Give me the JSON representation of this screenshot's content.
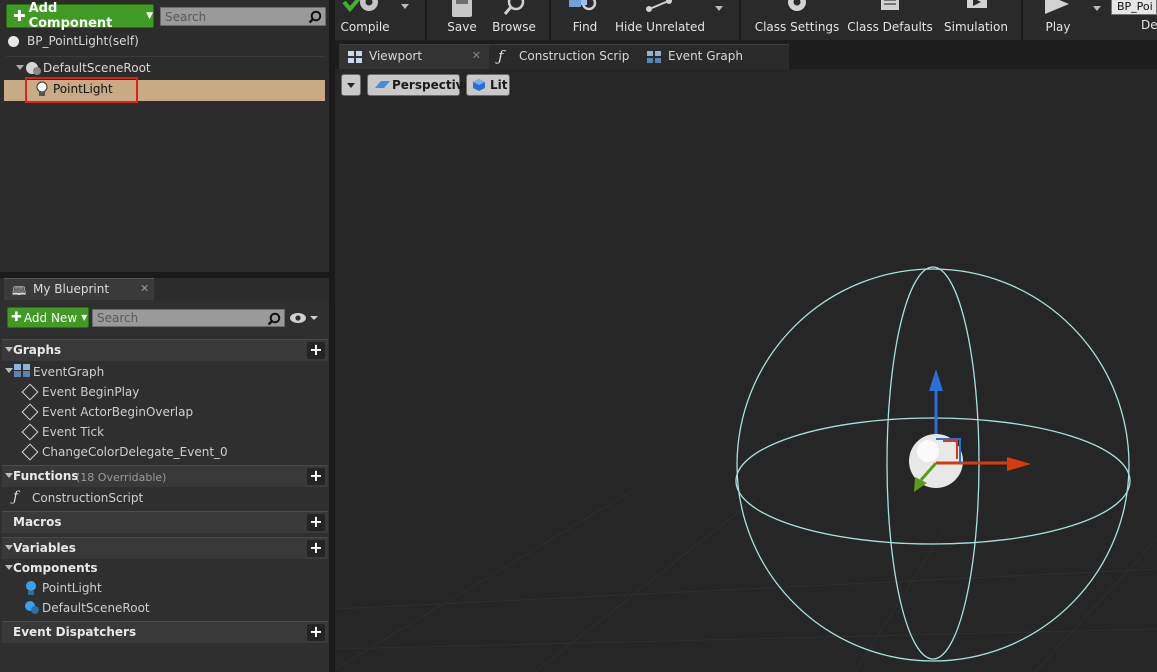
{
  "components_panel": {
    "add_component_label": "Add Component",
    "search_placeholder": "Search",
    "self_label": "BP_PointLight(self)",
    "tree": [
      {
        "label": "DefaultSceneRoot"
      },
      {
        "label": "PointLight",
        "selected": true
      }
    ]
  },
  "my_blueprint": {
    "tab_label": "My Blueprint",
    "add_new_label": "Add New",
    "search_placeholder": "Search",
    "sections": {
      "graphs": "Graphs",
      "functions": "Functions",
      "functions_note": "(18 Overridable)",
      "macros": "Macros",
      "variables": "Variables",
      "components": "Components",
      "event_dispatchers": "Event Dispatchers"
    },
    "event_graph": "EventGraph",
    "events": [
      "Event BeginPlay",
      "Event ActorBeginOverlap",
      "Event Tick",
      "ChangeColorDelegate_Event_0"
    ],
    "construction_script": "ConstructionScript",
    "component_items": [
      "PointLight",
      "DefaultSceneRoot"
    ]
  },
  "toolbar": {
    "compile": "Compile",
    "save": "Save",
    "browse": "Browse",
    "find": "Find",
    "hide_unrelated": "Hide Unrelated",
    "class_settings": "Class Settings",
    "class_defaults": "Class Defaults",
    "simulation": "Simulation",
    "play": "Play",
    "debug_object": "BP_Poi",
    "debug_label": "De"
  },
  "tabs": [
    "Viewport",
    "Construction Scrip",
    "Event Graph"
  ],
  "viewport": {
    "perspective_label": "Perspective",
    "lit_label": "Lit"
  },
  "colors": {
    "accent_green": "#3f9b24",
    "selection_tan": "#c8aa85",
    "highlight_red": "#e02020",
    "gizmo_x": "#d83a0f",
    "gizmo_y": "#5a9c1a",
    "gizmo_z": "#2a6fd8",
    "sphere_wire": "#a8e0e0"
  }
}
